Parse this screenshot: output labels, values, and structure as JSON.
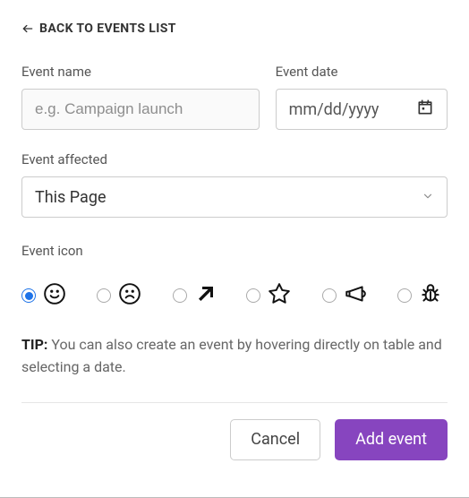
{
  "back": {
    "label": "BACK TO EVENTS LIST"
  },
  "fields": {
    "name": {
      "label": "Event name",
      "placeholder": "e.g. Campaign launch",
      "value": ""
    },
    "date": {
      "label": "Event date",
      "placeholder": "mm/dd/yyyy",
      "value": ""
    },
    "affected": {
      "label": "Event affected",
      "value": "This Page"
    },
    "icon": {
      "label": "Event icon",
      "options": [
        "smile",
        "frown",
        "arrow-up-right",
        "star",
        "megaphone",
        "bug"
      ],
      "selected_index": 0
    }
  },
  "tip": {
    "prefix": "TIP:",
    "text": " You can also create an event by hovering directly on table and selecting a date."
  },
  "actions": {
    "cancel": "Cancel",
    "submit": "Add event"
  },
  "colors": {
    "primary": "#8745bf",
    "accent_radio": "#1e73e8"
  }
}
